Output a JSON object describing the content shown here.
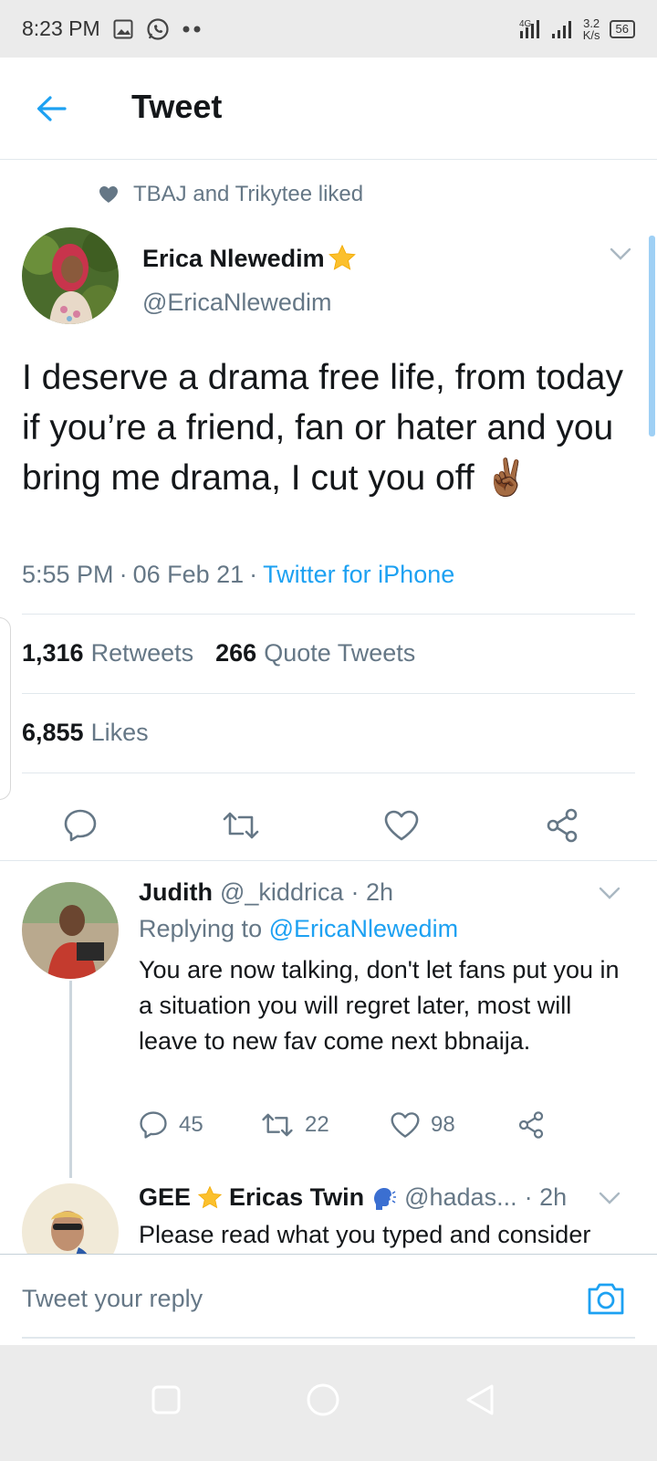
{
  "status_bar": {
    "time": "8:23 PM",
    "signal_label": "4G",
    "speed_value": "3.2",
    "speed_unit": "K/s",
    "battery": "56"
  },
  "header": {
    "title": "Tweet"
  },
  "social_context": {
    "text": "TBAJ and Trikytee liked"
  },
  "tweet": {
    "author_name": "Erica Nlewedim",
    "author_handle": "@EricaNlewedim",
    "text": "I deserve a drama free life, from today if you’re a friend, fan or hater and you bring me drama, I cut you off",
    "emoji": "✌🏾",
    "time": "5:55 PM",
    "date": "06 Feb 21",
    "separator": "·",
    "source": "Twitter for iPhone",
    "retweets_count": "1,316",
    "retweets_label": "Retweets",
    "quotes_count": "266",
    "quotes_label": "Quote Tweets",
    "likes_count": "6,855",
    "likes_label": "Likes"
  },
  "replies": [
    {
      "name": "Judith",
      "handle": "@_kiddrica",
      "time": "· 2h",
      "replying_prefix": "Replying to",
      "replying_to": "@EricaNlewedim",
      "text": "You are now talking, don't let fans put you in a situation you will regret later, most will leave to new fav come next bbnaija.",
      "reply_count": "45",
      "retweet_count": "22",
      "like_count": "98"
    },
    {
      "name_part1": "GEE",
      "name_part2": "Ericas Twin",
      "handle": "@hadas...",
      "time": "· 2h",
      "text": "Please read what you typed and consider"
    }
  ],
  "reply_bar": {
    "placeholder": "Tweet your reply"
  },
  "colors": {
    "accent": "#1da1f2",
    "text": "#14171a",
    "secondary": "#657786",
    "divider": "#e1e8ed"
  }
}
